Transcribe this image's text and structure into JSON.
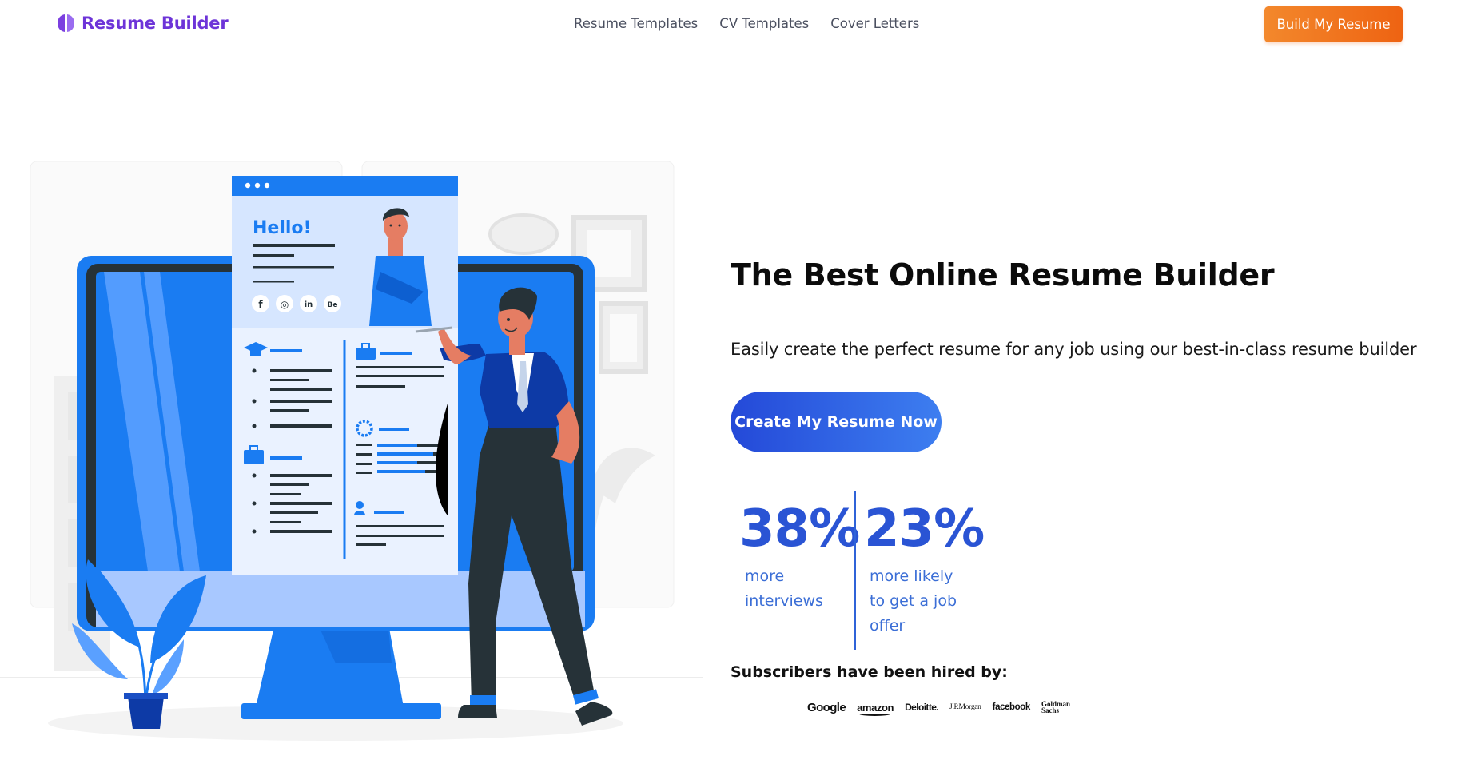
{
  "nav": {
    "brand": "Resume Builder",
    "brand_icon": "resume-builder-logo-icon",
    "links": [
      "Resume Templates",
      "CV Templates",
      "Cover Letters"
    ],
    "cta": "Build My Resume"
  },
  "hero": {
    "title": "The Best Online Resume Builder",
    "subtitle": "Easily create the perfect resume for any job using our best-in-class resume builder",
    "cta": "Create My Resume Now"
  },
  "illustration": {
    "greeting": "Hello!",
    "social_icons": [
      "facebook-icon",
      "instagram-icon",
      "linkedin-icon",
      "behance-icon"
    ],
    "social_labels": [
      "f",
      "◎",
      "in",
      "Be"
    ]
  },
  "stats": [
    {
      "value": "38%",
      "label": "more interviews"
    },
    {
      "value": "23%",
      "label": "more likely to get a job offer"
    }
  ],
  "hired": {
    "title": "Subscribers have been hired by:",
    "companies": [
      "Google",
      "amazon",
      "Deloitte.",
      "J.P.Morgan",
      "facebook",
      "Goldman Sachs"
    ]
  },
  "colors": {
    "brand_purple": "#6d34d8",
    "orange_start": "#f3882c",
    "orange_end": "#ee6312",
    "blue_start": "#2449d8",
    "blue_end": "#3d7ef0",
    "stat_blue": "#2a54d4",
    "illustration_blue": "#1a7cf2"
  }
}
